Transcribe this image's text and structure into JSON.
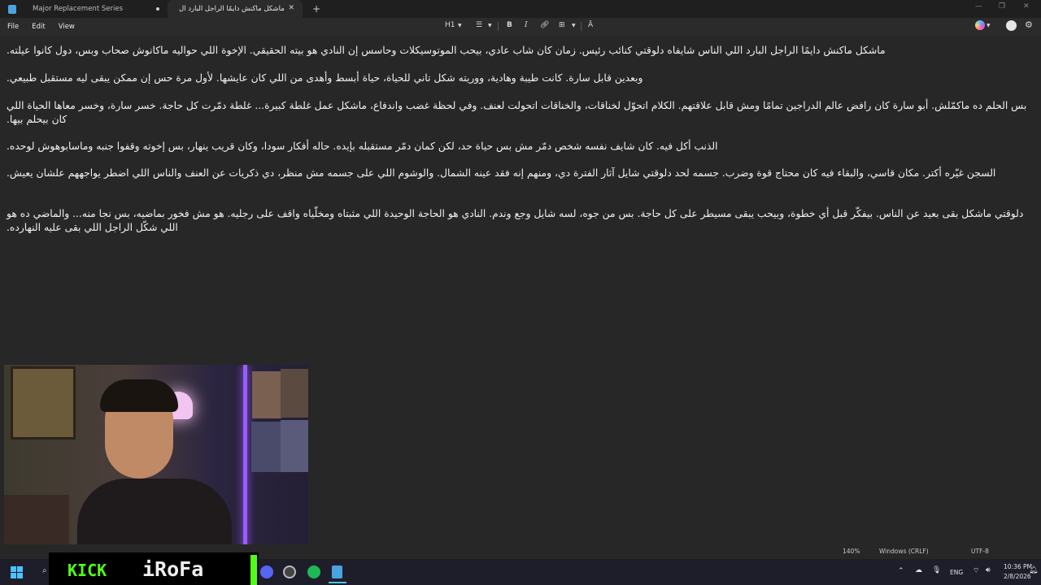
{
  "window": {
    "tabs": [
      {
        "label": "Major Replacement Series",
        "state": "unsaved"
      },
      {
        "label": "ماشكل ماكنش دايمًا الراجل البارد ال",
        "state": "active"
      }
    ],
    "new_tab_glyph": "+"
  },
  "menu": {
    "file": "File",
    "edit": "Edit",
    "view": "View"
  },
  "toolbar": {
    "heading": "H1",
    "list_icon": "list-icon",
    "bold": "B",
    "italic": "I",
    "link_icon": "link-icon",
    "table_icon": "table-icon",
    "clear_format_icon": "clear-format-icon"
  },
  "document": {
    "paragraphs": [
      "ماشكل ماكنش دايمًا الراجل البارد اللي الناس شايفاه دلوقتي كنائب رئيس. زمان كان شاب عادي، بيحب الموتوسيكلات وحاسس إن النادي هو بيته الحقيقي. الإخوة اللي حواليه ماكانوش صحاب وبس، دول كانوا عيلته.",
      "وبعدين قابل سارة. كانت طيبة وهادية، ووريته شكل تاني للحياة، حياة أبسط وأهدى من اللي كان عايشها. لأول مرة حس إن ممكن يبقى ليه مستقبل طبيعي.",
      "بس الحلم ده ماكمّلش. أبو سارة كان رافض عالم الدراجين تمامًا ومش قابل علاقتهم. الكلام اتحوّل لخناقات، والخناقات اتحولت لعنف. وفي لحظة غضب واندفاع، ماشكل عمل غلطة كبيرة... غلطة دمّرت كل حاجة. خسر سارة، وخسر معاها الحياة اللي كان بيحلم بيها.",
      "الذنب أكل فيه. كان شايف نفسه شخص دمّر مش بس حياة حد، لكن كمان دمّر مستقبله بإيده. حاله أفكار سودا، وكان قريب ينهار، بس إخوته وقفوا جنبه وماسابوهوش لوحده.",
      "السجن غيّره أكتر. مكان قاسي، والبقاء فيه كان محتاج قوة وضرب. جسمه لحد دلوقتي شايل آثار الفترة دي، ومنهم إنه فقد عينه الشمال. والوشوم اللي على جسمه مش منظر، دي ذكريات عن العنف والناس اللي اضطر يواجههم علشان يعيش.",
      "دلوقتي ماشكل بقى بعيد عن الناس. بيفكّر قبل أي خطوة، وبيحب يبقى مسيطر على كل حاجة. بس من جوه، لسه شايل وجع وندم. النادي هو الحاجة الوحيدة اللي مثبتاه ومخلّياه واقف على رجليه. هو مش فخور بماضيه، بس نجا منه... والماضي ده هو اللي شكّل الراجل اللي بقى عليه النهارده."
    ]
  },
  "status": {
    "zoom": "140%",
    "line_ending": "Windows (CRLF)",
    "encoding": "UTF-8"
  },
  "overlay": {
    "platform": "KICK",
    "streamer": "iRoFa"
  },
  "taskbar": {
    "lang": "ENG",
    "time": "10:36 PM",
    "date": "2/8/2026"
  },
  "colors": {
    "kick_green": "#53fc18",
    "editor_bg": "#272727",
    "accent": "#4cc2ff"
  }
}
